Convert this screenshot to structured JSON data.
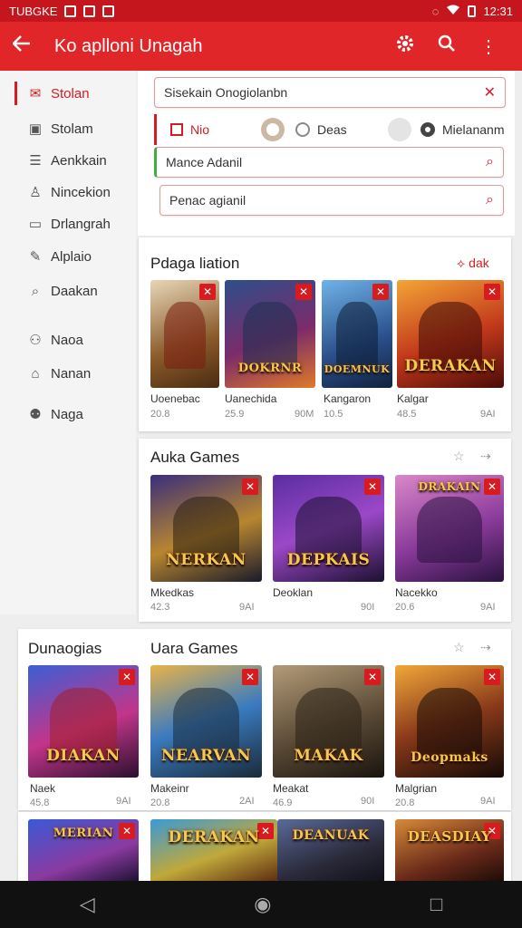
{
  "status": {
    "left_text": "TUBGKE",
    "time": "12:31"
  },
  "appbar": {
    "title": "Ko aplloni Unagah"
  },
  "sidebar": {
    "items": [
      {
        "label": "Stolan",
        "icon": "mail-icon"
      },
      {
        "label": "Stolam",
        "icon": "square-icon"
      },
      {
        "label": "Aenkkain",
        "icon": "list-icon"
      },
      {
        "label": "Nincekion",
        "icon": "person-icon"
      },
      {
        "label": "Drlangrah",
        "icon": "doc-icon"
      },
      {
        "label": "Alplaio",
        "icon": "pen-icon"
      },
      {
        "label": "Daakan",
        "icon": "search-icon"
      },
      {
        "label": "Naoa",
        "icon": "people-icon"
      },
      {
        "label": "Nanan",
        "icon": "store-icon"
      },
      {
        "label": "Naga",
        "icon": "group-icon"
      }
    ]
  },
  "filters": {
    "search1": "Sisekain Onogiolanbn",
    "radio1": "Nio",
    "radio2": "Deas",
    "radio3": "Mielananm",
    "search2": "Mance Adanil",
    "search3": "Penac agianil"
  },
  "sections": {
    "s1": {
      "title": "Pdaga liation",
      "action": "dak",
      "tiles": [
        {
          "logo": "",
          "name": "Uoenebac",
          "rating": "20.8",
          "size": ""
        },
        {
          "logo": "DOKRNR",
          "name": "Uanechida",
          "rating": "25.9",
          "size": "90M"
        },
        {
          "logo": "DOEMNUK",
          "name": "Kangaron",
          "rating": "10.5",
          "size": ""
        },
        {
          "logo": "DERAKAN",
          "name": "Kalgar",
          "rating": "48.5",
          "size": "9AI"
        }
      ]
    },
    "s2": {
      "title": "Auka Games",
      "tiles": [
        {
          "logo": "NERKAN",
          "name": "Mkedkas",
          "rating": "42.3",
          "size": "9AI"
        },
        {
          "logo": "DEPKAIS",
          "name": "Deoklan",
          "rating": "",
          "size": "90I"
        },
        {
          "logo": "DRAKAIN",
          "name": "Nacekko",
          "rating": "20.6",
          "size": "9AI"
        }
      ]
    },
    "s3": {
      "left_title": "Dunaogias",
      "title": "Uara Games",
      "tiles": [
        {
          "logo": "DIAKAN",
          "name": "Naek",
          "rating": "45.8",
          "size": "9AI"
        },
        {
          "logo": "NEARVAN",
          "name": "Makeinr",
          "rating": "20.8",
          "size": "2AI"
        },
        {
          "logo": "MAKAK",
          "name": "Meakat",
          "rating": "46.9",
          "size": "90I"
        },
        {
          "logo": "Deopmaks",
          "name": "Malgrian",
          "rating": "20.8",
          "size": "9AI"
        }
      ]
    },
    "s4": {
      "tiles": [
        {
          "logo": "MERIAN"
        },
        {
          "logo": "DERAKAN"
        },
        {
          "logo": "DEANUAK"
        },
        {
          "logo": "DEASDIAY"
        }
      ]
    }
  },
  "colors": {
    "accent": "#e02629",
    "statusbar": "#c4161c"
  }
}
